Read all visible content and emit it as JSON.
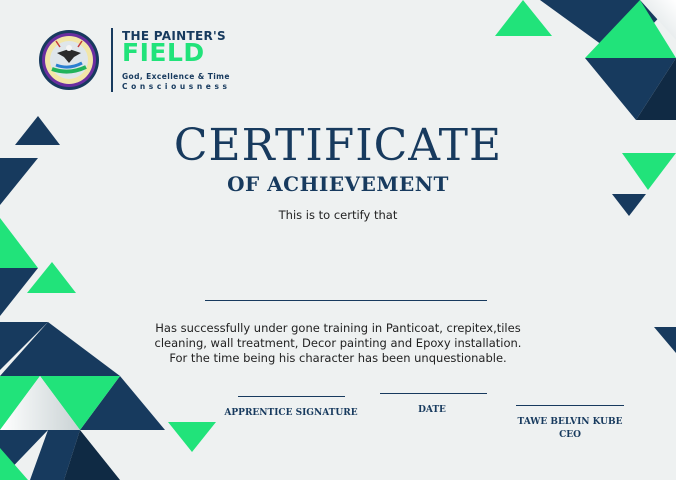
{
  "brand": {
    "name_line1": "THE PAINTER'S",
    "name_line2": "FIELD",
    "tagline_line1": "God, Excellence & Time",
    "tagline_line2": "Consciousness"
  },
  "certificate": {
    "title": "CERTIFICATE",
    "subtitle": "OF ACHIEVEMENT",
    "intro": "This is to certify that",
    "recipient_name": "",
    "body_lines": [
      "Has successfully under gone training in Panticoat, crepitex,tiles",
      "cleaning, wall treatment, Decor painting and Epoxy installation.",
      "For the time being his character has been unquestionable."
    ]
  },
  "signatures": {
    "apprentice": "APPRENTICE SIGNATURE",
    "date": "DATE",
    "ceo_name": "TAWE BELVIN KUBE",
    "ceo_title": "CEO"
  },
  "colors": {
    "navy": "#173a5e",
    "green": "#21e37a",
    "background": "#eef1f1"
  },
  "icons": {
    "logo": "eagle-emblem-icon"
  }
}
